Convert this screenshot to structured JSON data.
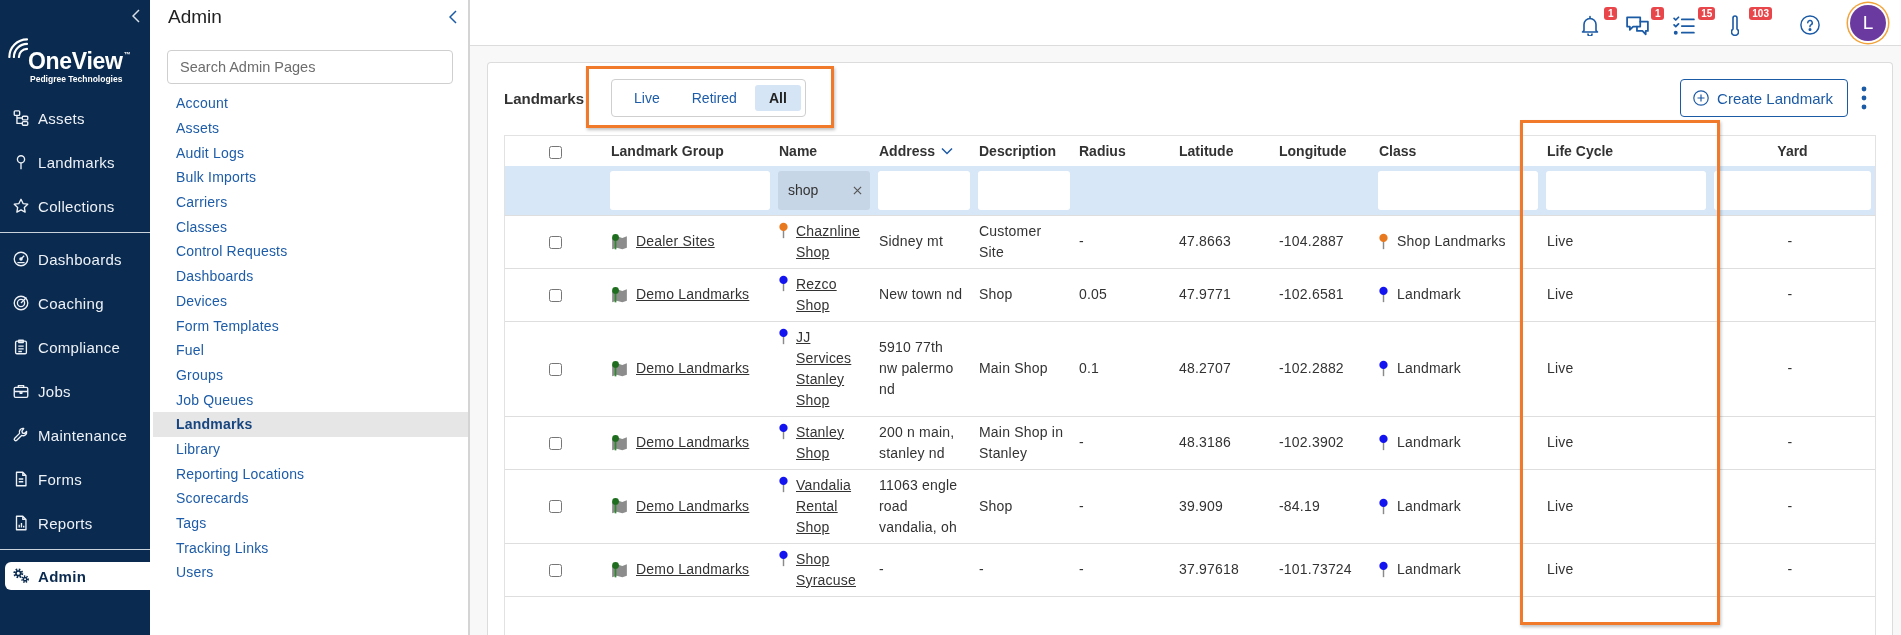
{
  "sidebar": {
    "logo": {
      "name": "OneView$^{™}$",
      "tagline": "Pedigree Technologies"
    },
    "groups": [
      {
        "items": [
          {
            "label": "Assets",
            "selected": false
          },
          {
            "label": "Landmarks",
            "selected": false
          },
          {
            "label": "Collections",
            "selected": false
          }
        ]
      },
      {
        "items": [
          {
            "label": "Dashboards",
            "selected": false
          },
          {
            "label": "Coaching",
            "selected": false
          },
          {
            "label": "Compliance",
            "selected": false
          },
          {
            "label": "Jobs",
            "selected": false
          },
          {
            "label": "Maintenance",
            "selected": false
          },
          {
            "label": "Forms",
            "selected": false
          },
          {
            "label": "Reports",
            "selected": false
          }
        ]
      },
      {
        "items": [
          {
            "label": "Admin",
            "selected": true
          }
        ]
      }
    ]
  },
  "admin_panel": {
    "title": "Admin",
    "search": {
      "placeholder": "Search Admin Pages"
    },
    "items": [
      {
        "label": "Account",
        "selected": false
      },
      {
        "label": "Assets",
        "selected": false
      },
      {
        "label": "Audit Logs",
        "selected": false
      },
      {
        "label": "Bulk Imports",
        "selected": false
      },
      {
        "label": "Carriers",
        "selected": false
      },
      {
        "label": "Classes",
        "selected": false
      },
      {
        "label": "Control Requests",
        "selected": false
      },
      {
        "label": "Dashboards",
        "selected": false
      },
      {
        "label": "Devices",
        "selected": false
      },
      {
        "label": "Form Templates",
        "selected": false
      },
      {
        "label": "Fuel",
        "selected": false
      },
      {
        "label": "Groups",
        "selected": false
      },
      {
        "label": "Job Queues",
        "selected": false
      },
      {
        "label": "Landmarks",
        "selected": true
      },
      {
        "label": "Library",
        "selected": false
      },
      {
        "label": "Reporting Locations",
        "selected": false
      },
      {
        "label": "Scorecards",
        "selected": false
      },
      {
        "label": "Tags",
        "selected": false
      },
      {
        "label": "Tracking Links",
        "selected": false
      },
      {
        "label": "Users",
        "selected": false
      }
    ]
  },
  "top_bar": {
    "alerts": [
      {
        "badge": "1"
      },
      {
        "badge": "1"
      },
      {
        "badge": "15"
      },
      {
        "badge": "103"
      }
    ],
    "avatar": {
      "initial": "L"
    }
  },
  "landmarks": {
    "title": "Landmarks",
    "view_filter": {
      "highlighted": true,
      "options": [
        {
          "label": "Live",
          "selected": false
        },
        {
          "label": "Retired",
          "selected": false
        },
        {
          "label": "All",
          "selected": true
        }
      ]
    },
    "create_button": {
      "label": "Create Landmark"
    },
    "table": {
      "select_all": {
        "checked": false
      },
      "columns": [
        {
          "label": "Landmark Group",
          "filterable": true,
          "sorted": false,
          "highlighted": false
        },
        {
          "label": "Name",
          "filterable": true,
          "filter_value": "shop",
          "sorted": false,
          "highlighted": false
        },
        {
          "label": "Address",
          "filterable": true,
          "sorted": true,
          "highlighted": false
        },
        {
          "label": "Description",
          "filterable": true,
          "sorted": false,
          "highlighted": false
        },
        {
          "label": "Radius",
          "filterable": false,
          "sorted": false,
          "highlighted": false
        },
        {
          "label": "Latitude",
          "filterable": false,
          "sorted": false,
          "highlighted": false
        },
        {
          "label": "Longitude",
          "filterable": false,
          "sorted": false,
          "highlighted": false
        },
        {
          "label": "Class",
          "filterable": true,
          "sorted": false,
          "highlighted": false
        },
        {
          "label": "Life Cycle",
          "filterable": true,
          "sorted": false,
          "highlighted": true
        },
        {
          "label": "Yard",
          "filterable": true,
          "sorted": false,
          "highlighted": false
        }
      ],
      "rows": [
        {
          "checked": false,
          "landmark_group": "Dealer Sites",
          "name": "Chaznline Shop",
          "address": "Sidney mt",
          "description": "Customer Site",
          "radius": "-",
          "latitude": "47.8663",
          "longitude": "-104.2887",
          "class": "Shop Landmarks",
          "color": "#e8791f",
          "life_cycle": "Live",
          "yard": "-"
        },
        {
          "checked": false,
          "landmark_group": "Demo Landmarks",
          "name": "Rezco Shop",
          "address": "New town nd",
          "description": "Shop",
          "radius": "0.05",
          "latitude": "47.9771",
          "longitude": "-102.6581",
          "class": "Landmark",
          "color": "#1414f0",
          "life_cycle": "Live",
          "yard": "-"
        },
        {
          "checked": false,
          "landmark_group": "Demo Landmarks",
          "name": "JJ Services Stanley Shop",
          "address": "5910 77th nw palermo nd",
          "description": "Main Shop",
          "radius": "0.1",
          "latitude": "48.2707",
          "longitude": "-102.2882",
          "class": "Landmark",
          "color": "#1414f0",
          "life_cycle": "Live",
          "yard": "-"
        },
        {
          "checked": false,
          "landmark_group": "Demo Landmarks",
          "name": "Stanley Shop",
          "address": "200 n main, stanley nd",
          "description": "Main Shop in Stanley",
          "radius": "-",
          "latitude": "48.3186",
          "longitude": "-102.3902",
          "class": "Landmark",
          "color": "#1414f0",
          "life_cycle": "Live",
          "yard": "-"
        },
        {
          "checked": false,
          "landmark_group": "Demo Landmarks",
          "name": "Vandalia Rental Shop",
          "address": "11063 engle road vandalia, oh",
          "description": "Shop",
          "radius": "-",
          "latitude": "39.909",
          "longitude": "-84.19",
          "class": "Landmark",
          "color": "#1414f0",
          "life_cycle": "Live",
          "yard": "-"
        },
        {
          "checked": false,
          "landmark_group": "Demo Landmarks",
          "name": "Shop Syracuse",
          "address": "-",
          "description": "-",
          "radius": "-",
          "latitude": "37.97618",
          "longitude": "-101.73724",
          "class": "Landmark",
          "color": "#1414f0",
          "life_cycle": "Live",
          "yard": "-"
        }
      ]
    }
  }
}
